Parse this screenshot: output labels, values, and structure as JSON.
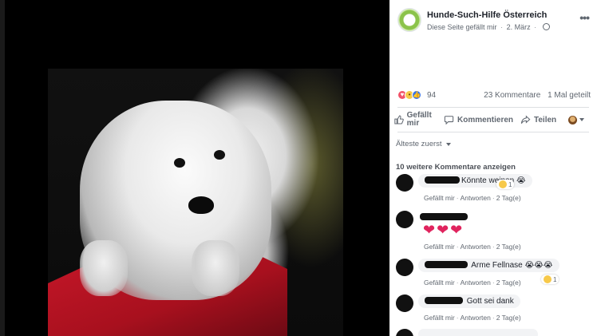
{
  "post": {
    "page_name": "Hunde-Such-Hilfe Österreich",
    "liked_text": "Diese Seite gefällt mir",
    "separator": "·",
    "date": "2. März",
    "more_icon": "more-dots-icon"
  },
  "stats": {
    "reaction_count": "94",
    "comments": "23 Kommentare",
    "shares": "1 Mal geteilt"
  },
  "actions": {
    "like": "Gefällt mir",
    "comment": "Kommentieren",
    "share": "Teilen"
  },
  "sort": {
    "label": "Älteste zuerst"
  },
  "more_comments": "10 weitere Kommentare anzeigen",
  "comments": [
    {
      "text": "Könnte weinen",
      "emoji": "😭",
      "reaction_count": "1",
      "like": "Gefällt mir",
      "reply": "Antworten",
      "time": "2 Tag(e)"
    },
    {
      "text": "",
      "like": "Gefällt mir",
      "reply": "Antworten",
      "time": "2 Tag(e)",
      "hearts": "❤❤❤"
    },
    {
      "text": "Arme Fellnase",
      "emoji": "😭😭😭",
      "reaction_count": "1",
      "like": "Gefällt mir",
      "reply": "Antworten",
      "time": "2 Tag(e)"
    },
    {
      "text": "Gott sei dank",
      "like": "Gefällt mir",
      "reply": "Antworten",
      "time": "2 Tag(e)"
    }
  ],
  "colors": {
    "panel_bg": "#ffffff",
    "link_text": "#4b4f56",
    "meta_text": "#606770",
    "love": "#f25268",
    "like": "#3b74e6",
    "sad": "#f7c94a"
  }
}
